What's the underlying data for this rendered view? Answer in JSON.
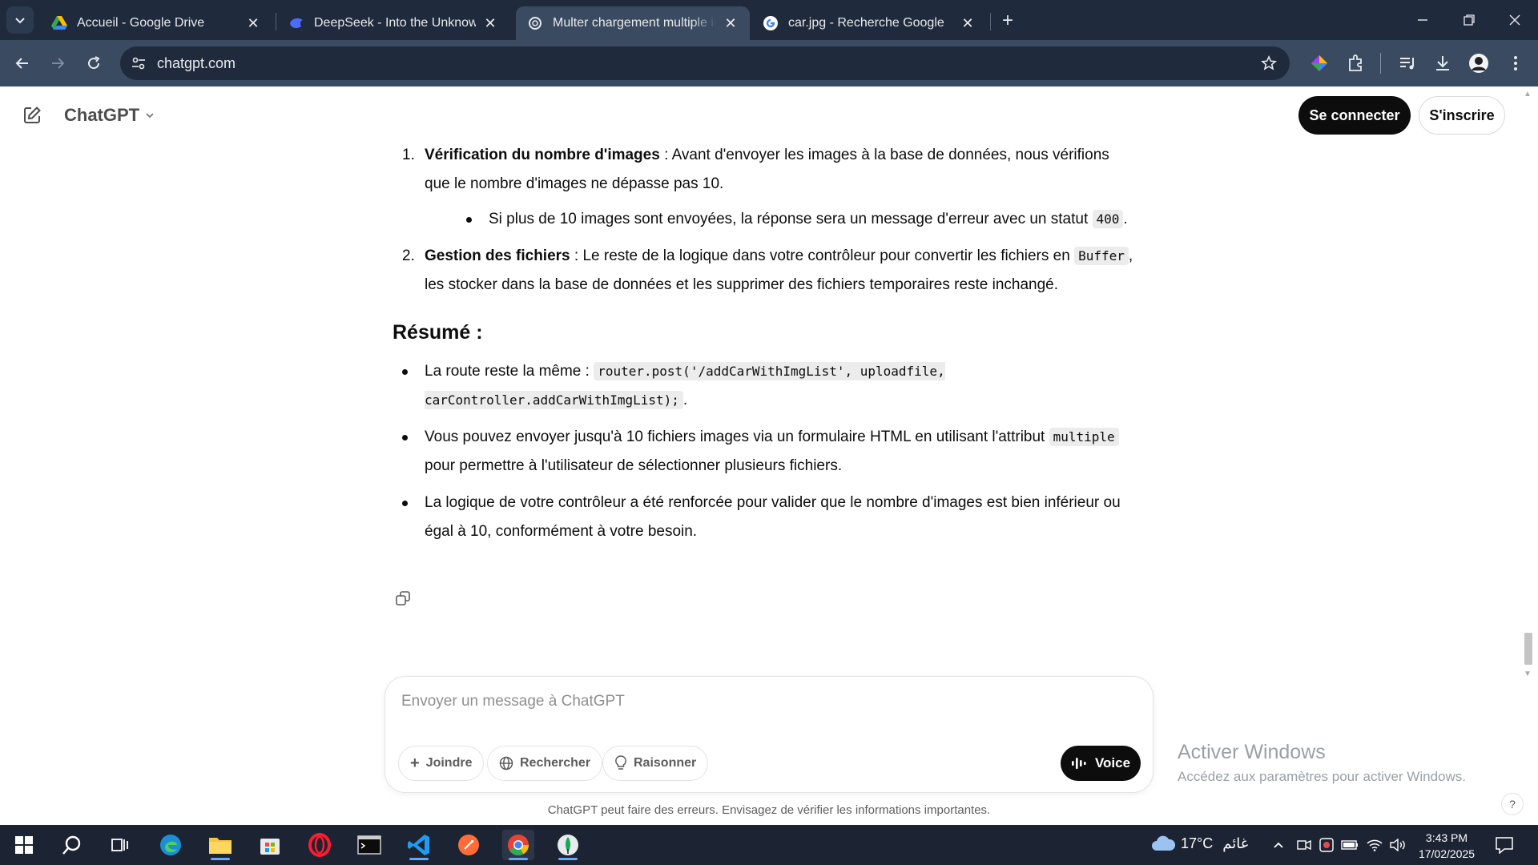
{
  "browser": {
    "tabs": [
      {
        "title": "Accueil - Google Drive",
        "icon": "google-drive-icon"
      },
      {
        "title": "DeepSeek - Into the Unknown",
        "icon": "deepseek-icon"
      },
      {
        "title": "Multer chargement multiple im",
        "icon": "chatgpt-icon",
        "active": true
      },
      {
        "title": "car.jpg - Recherche Google",
        "icon": "google-icon"
      }
    ],
    "url": "chatgpt.com"
  },
  "header": {
    "model": "ChatGPT",
    "login_label": "Se connecter",
    "signup_label": "S'inscrire"
  },
  "message": {
    "ol": [
      {
        "num": "1.",
        "bold": "Vérification du nombre d'images",
        "text": " : Avant d'envoyer les images à la base de données, nous vérifions que le nombre d'images ne dépasse pas 10.",
        "sub": {
          "text_before": "Si plus de 10 images sont envoyées, la réponse sera un message d'erreur avec un statut ",
          "code": "400",
          "text_after": "."
        }
      },
      {
        "num": "2.",
        "bold": "Gestion des fichiers",
        "text": " : Le reste de la logique dans votre contrôleur pour convertir les fichiers en ",
        "code": "Buffer",
        "text_after": ", les stocker dans la base de données et les supprimer des fichiers temporaires reste inchangé."
      }
    ],
    "summary_heading": "Résumé :",
    "summary": [
      {
        "text_before": "La route reste la même : ",
        "code": "router.post('/addCarWithImgList', uploadfile, carController.addCarWithImgList);",
        "text_after": "."
      },
      {
        "text_before": "Vous pouvez envoyer jusqu'à 10 fichiers images via un formulaire HTML en utilisant l'attribut ",
        "code": "multiple",
        "text_after": " pour permettre à l'utilisateur de sélectionner plusieurs fichiers."
      },
      {
        "text_before": "La logique de votre contrôleur a été renforcée pour valider que le nombre d'images est bien inférieur ou égal à 10, conformément à votre besoin.",
        "code": "",
        "text_after": ""
      }
    ]
  },
  "composer": {
    "placeholder": "Envoyer un message à ChatGPT",
    "attach_label": "Joindre",
    "search_label": "Rechercher",
    "reason_label": "Raisonner",
    "voice_label": "Voice"
  },
  "disclaimer": "ChatGPT peut faire des erreurs. Envisagez de vérifier les informations importantes.",
  "help_label": "?",
  "watermark": {
    "title": "Activer Windows",
    "subtitle": "Accédez aux paramètres pour activer Windows."
  },
  "taskbar": {
    "weather_temp": "17°C",
    "weather_desc": "غائم",
    "time": "3:43 PM",
    "date": "17/02/2025"
  },
  "colors": {
    "tabstrip": "#1f2a3c",
    "toolbar": "#3a4a60",
    "primary_button": "#0d0d0d",
    "taskbar": "#1c2333"
  }
}
